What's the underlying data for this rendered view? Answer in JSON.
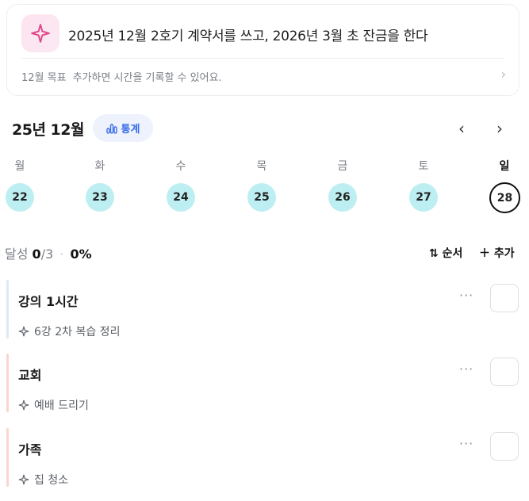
{
  "goal": {
    "title": "2025년 12월 2호기 계약서를 쓰고, 2026년 3월 초 잔금을 한다",
    "month_label": "12월 목표",
    "hint": "추가하면 시간을 기록할 수 있어요.",
    "icon": "sparkle-icon"
  },
  "calendar": {
    "month_title": "25년 12월",
    "stats_label": "통계",
    "weekdays": [
      "월",
      "화",
      "수",
      "목",
      "금",
      "토",
      "일"
    ],
    "days": [
      "22",
      "23",
      "24",
      "25",
      "26",
      "27",
      "28"
    ],
    "selected_day": "28",
    "day_color": "#bdeff2"
  },
  "progress": {
    "label": "달성",
    "done": "0",
    "total": "/3",
    "sep": "·",
    "percent": "0%"
  },
  "toolbar": {
    "order_label": "순서",
    "add_label": "추가"
  },
  "tasks": [
    {
      "title": "강의 1시간",
      "subtask": "6강 2차 복습 정리",
      "bar_color": "#dfe8f7"
    },
    {
      "title": "교회",
      "subtask": "예배 드리기",
      "bar_color": "#fbd5cf"
    },
    {
      "title": "가족",
      "subtask": "집 청소",
      "bar_color": "#fbd5cf"
    }
  ]
}
